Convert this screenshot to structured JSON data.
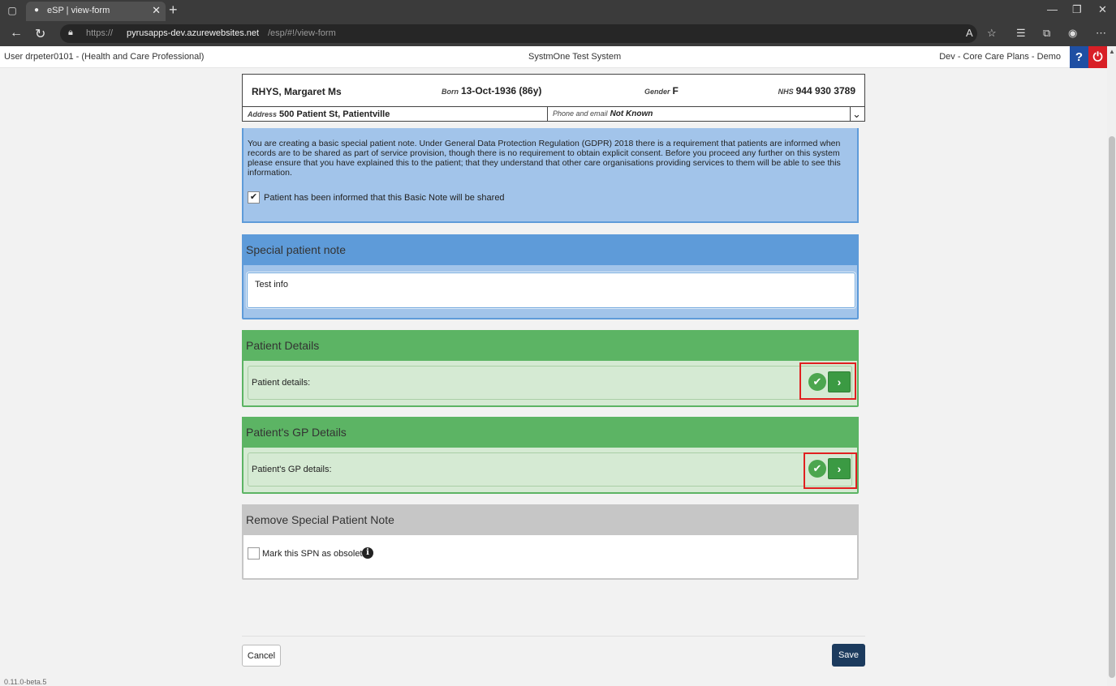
{
  "browser": {
    "tab_title": "eSP | view-form",
    "url_protocol": "https://",
    "url_host": "pyrusapps-dev.azurewebsites.net",
    "url_path": "/esp/#!/view-form"
  },
  "header": {
    "user": "User drpeter0101 - (Health and Care Professional)",
    "system": "SystmOne Test System",
    "environment": "Dev - Core Care Plans - Demo",
    "help_label": "?",
    "power_label": "⏻"
  },
  "patient": {
    "name": "RHYS, Margaret Ms",
    "born_label": "Born",
    "born_value": "13-Oct-1936 (86y)",
    "gender_label": "Gender",
    "gender_value": "F",
    "nhs_label": "NHS",
    "nhs_value": "944 930 3789",
    "address_label": "Address",
    "address_value": "500 Patient St, Patientville",
    "phone_label": "Phone and email",
    "phone_value": "Not Known"
  },
  "gdpr": {
    "text": "You are creating a basic special patient note. Under General Data Protection Regulation (GDPR) 2018 there is a requirement that patients are informed when records are to be shared as part of service provision, though there is no requirement to obtain explicit consent. Before you proceed any further on this system please ensure that you have explained this to the patient; that they understand that other care organisations providing services to them will be able to see this information.",
    "checkbox_label": "Patient has been informed that this Basic Note will be shared",
    "checked": true
  },
  "special_note": {
    "title": "Special patient note",
    "value": "Test info"
  },
  "patient_details": {
    "title": "Patient Details",
    "row_label": "Patient details:"
  },
  "gp_details": {
    "title": "Patient's GP Details",
    "row_label": "Patient's GP details:"
  },
  "remove": {
    "title": "Remove Special Patient Note",
    "checkbox_label": "Mark this SPN as obsolete",
    "checked": false
  },
  "footer": {
    "cancel_label": "Cancel",
    "save_label": "Save",
    "version": "0.11.0-beta.5"
  },
  "colors": {
    "info_panel": "#a2c4ea",
    "section_blue": "#5e9bd9",
    "section_green": "#5cb464",
    "section_grey": "#c6c6c6",
    "save_button": "#1c3b5e",
    "highlight": "#e02020"
  }
}
